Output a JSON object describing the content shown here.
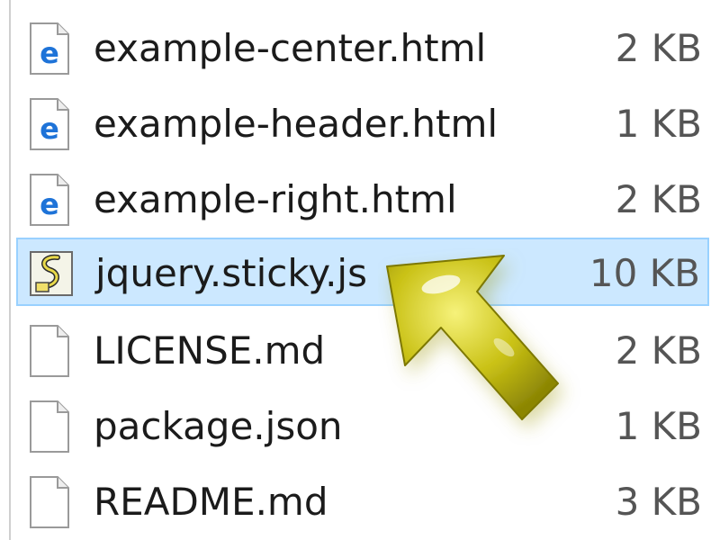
{
  "files": [
    {
      "name": "example-center.html",
      "size": "2 KB",
      "icon": "html-file-icon",
      "selected": false
    },
    {
      "name": "example-header.html",
      "size": "1 KB",
      "icon": "html-file-icon",
      "selected": false
    },
    {
      "name": "example-right.html",
      "size": "2 KB",
      "icon": "html-file-icon",
      "selected": false
    },
    {
      "name": "jquery.sticky.js",
      "size": "10 KB",
      "icon": "script-file-icon",
      "selected": true
    },
    {
      "name": "LICENSE.md",
      "size": "2 KB",
      "icon": "document-file-icon",
      "selected": false
    },
    {
      "name": "package.json",
      "size": "1 KB",
      "icon": "document-file-icon",
      "selected": false
    },
    {
      "name": "README.md",
      "size": "3 KB",
      "icon": "document-file-icon",
      "selected": false
    }
  ],
  "colors": {
    "selection_fill": "#cce8ff",
    "selection_border": "#99d1ff",
    "arrow": "#b8b20a"
  },
  "annotation": {
    "icon": "arrow-pointer-icon"
  }
}
